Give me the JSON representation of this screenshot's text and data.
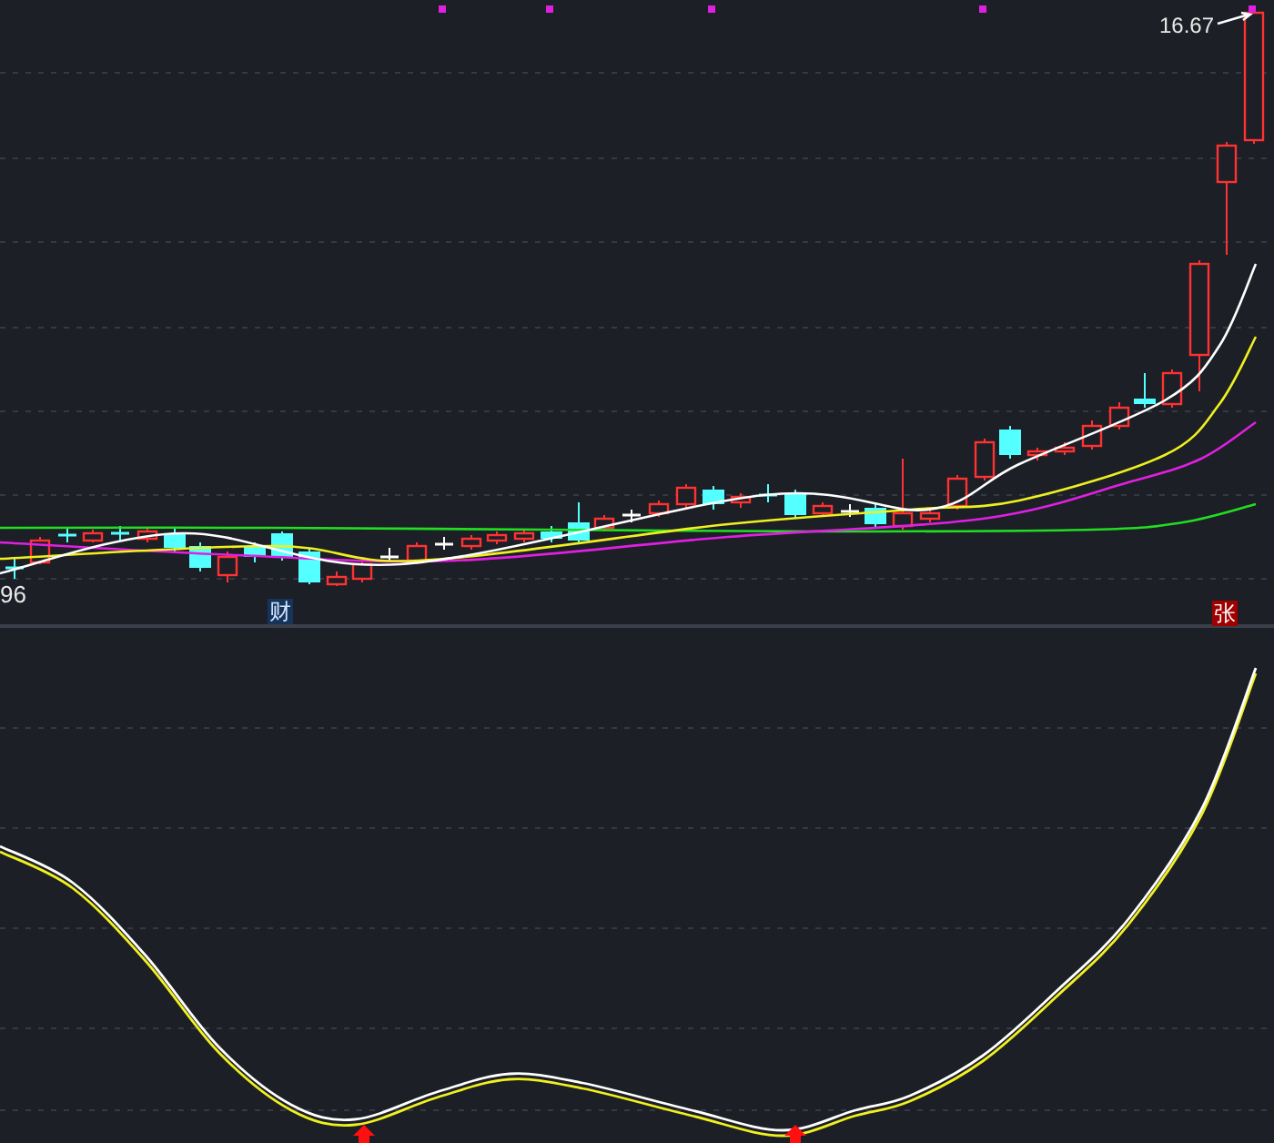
{
  "price_panel": {
    "high_label": "16.67",
    "low_label": "96",
    "event_markers": [
      {
        "text": "财",
        "kind": "finance"
      },
      {
        "text": "张",
        "kind": "limit_up"
      }
    ]
  }
}
